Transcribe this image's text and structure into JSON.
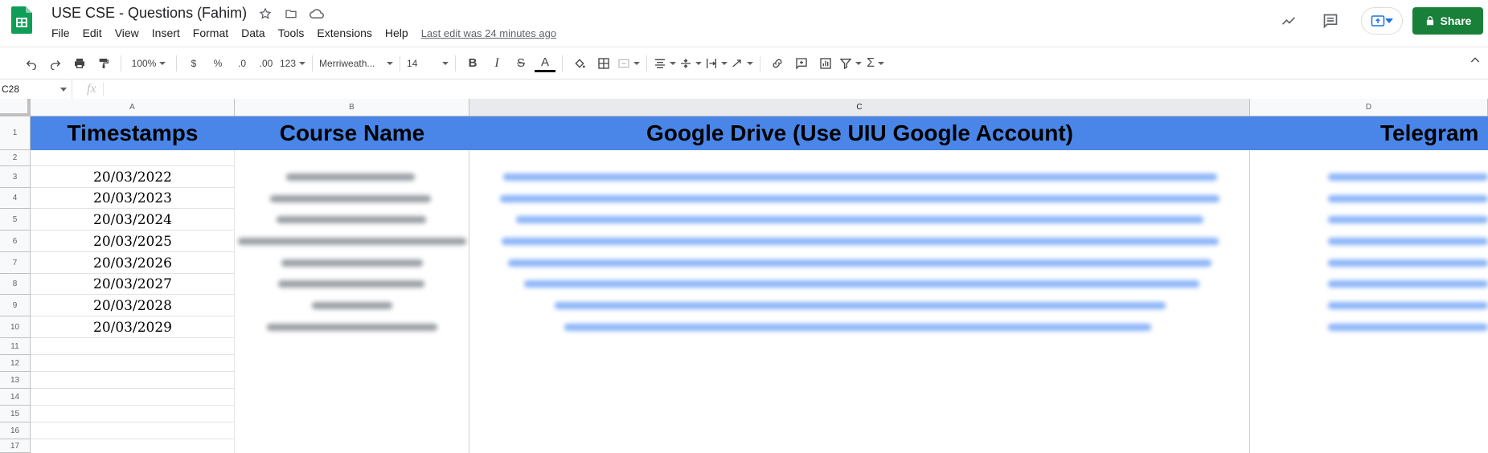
{
  "app": {
    "title": "USE CSE - Questions (Fahim)",
    "menu": [
      "File",
      "Edit",
      "View",
      "Insert",
      "Format",
      "Data",
      "Tools",
      "Extensions",
      "Help"
    ],
    "last_edit": "Last edit was 24 minutes ago",
    "share_label": "Share",
    "brand_color": "#188038"
  },
  "toolbar": {
    "zoom": "100%",
    "currency": "$",
    "percent": "%",
    "dec_decrease": ".0",
    "dec_increase": ".00",
    "more_formats": "123",
    "font": "Merriweath...",
    "font_size": "14",
    "bold": "B",
    "italic": "I",
    "strike": "S",
    "text_color": "A"
  },
  "formula_bar": {
    "cell_ref": "C28",
    "fx": "fx",
    "value": ""
  },
  "sheet": {
    "columns": [
      "A",
      "B",
      "C",
      "D"
    ],
    "selected_column": "C",
    "rows": [
      "1",
      "2",
      "3",
      "4",
      "5",
      "6",
      "7",
      "8",
      "9",
      "10",
      "11",
      "12",
      "13",
      "14",
      "15",
      "16",
      "17"
    ],
    "header_fill": "#4a86e8",
    "headers": {
      "a": "Timestamps",
      "b": "Course Name",
      "c": "Google Drive (Use UIU Google Account)",
      "d": "Telegram"
    },
    "timestamps": [
      "20/03/2022",
      "20/03/2023",
      "20/03/2024",
      "20/03/2025",
      "20/03/2026",
      "20/03/2027",
      "20/03/2028",
      "20/03/2029"
    ]
  }
}
